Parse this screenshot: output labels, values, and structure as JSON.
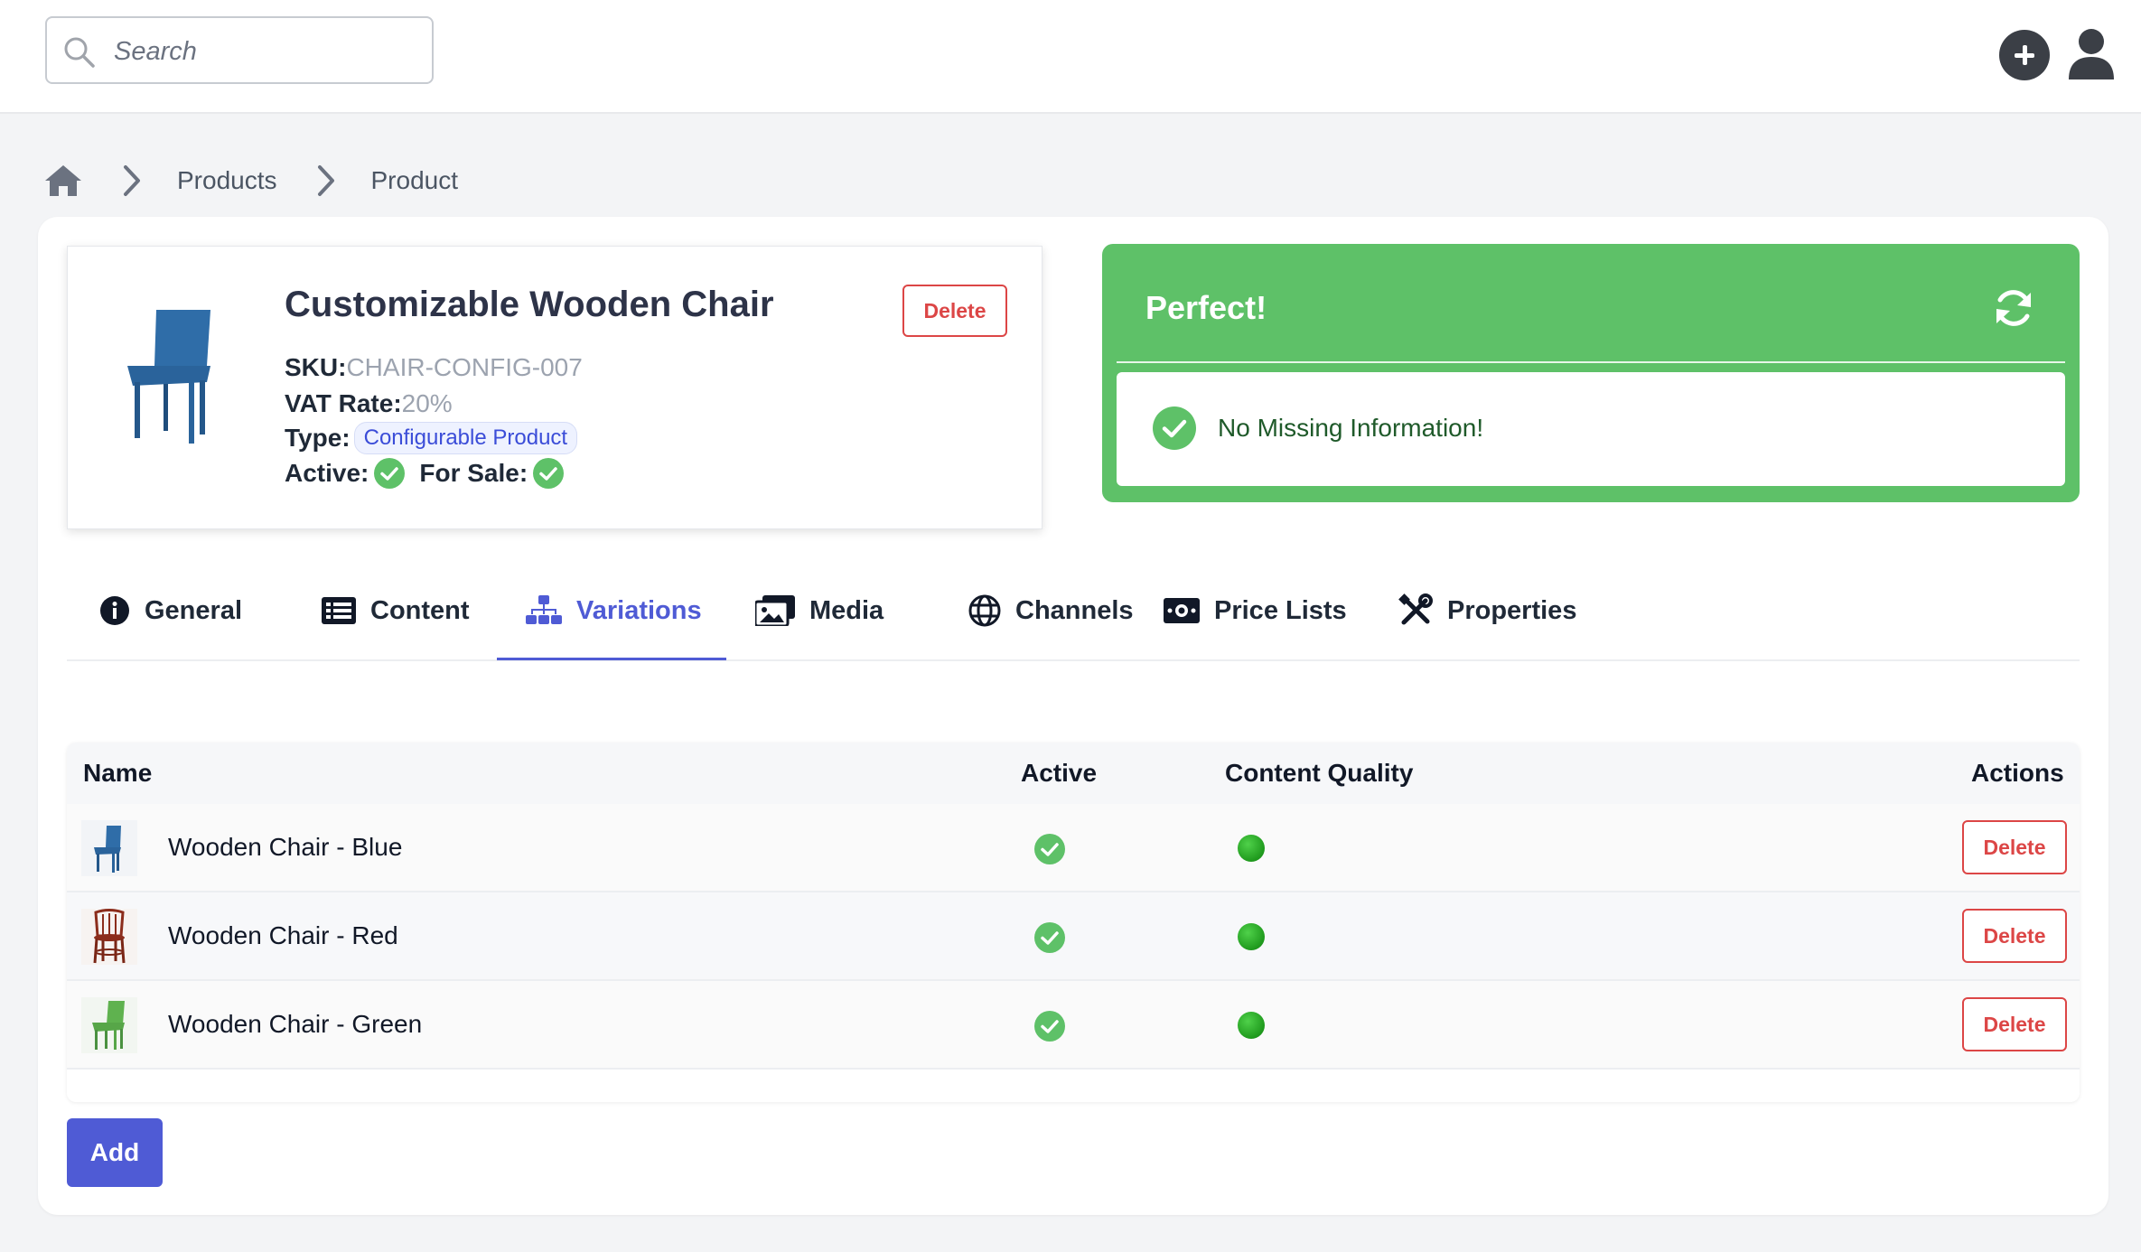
{
  "header": {
    "search_placeholder": "Search",
    "add_icon": "plus-circle-icon",
    "user_icon": "user-icon"
  },
  "breadcrumb": {
    "home_icon": "home-icon",
    "items": [
      "Products",
      "Product"
    ]
  },
  "product": {
    "title": "Customizable Wooden Chair",
    "delete_label": "Delete",
    "sku_label": "SKU:",
    "sku_value": "CHAIR-CONFIG-007",
    "vat_label": "VAT Rate:",
    "vat_value": "20%",
    "type_label": "Type:",
    "type_value": "Configurable Product",
    "active_label": "Active:",
    "for_sale_label": "For Sale:",
    "active": true,
    "for_sale": true,
    "image_color": "#2f6da8"
  },
  "status": {
    "title": "Perfect!",
    "message": "No Missing Information!",
    "color": "#5ec168",
    "refresh_icon": "refresh-icon"
  },
  "tabs": [
    {
      "label": "General",
      "icon": "info-icon",
      "active": false
    },
    {
      "label": "Content",
      "icon": "list-icon",
      "active": false
    },
    {
      "label": "Variations",
      "icon": "sitemap-icon",
      "active": true
    },
    {
      "label": "Media",
      "icon": "images-icon",
      "active": false
    },
    {
      "label": "Channels",
      "icon": "globe-icon",
      "active": false
    },
    {
      "label": "Price Lists",
      "icon": "money-icon",
      "active": false
    },
    {
      "label": "Properties",
      "icon": "tools-icon",
      "active": false
    }
  ],
  "table": {
    "columns": [
      "Name",
      "Active",
      "Content Quality",
      "Actions"
    ],
    "rows": [
      {
        "name": "Wooden Chair - Blue",
        "active": true,
        "quality": "good",
        "action": "Delete",
        "color": "#2f6da8"
      },
      {
        "name": "Wooden Chair - Red",
        "active": true,
        "quality": "good",
        "action": "Delete",
        "color": "#8c2d1c"
      },
      {
        "name": "Wooden Chair - Green",
        "active": true,
        "quality": "good",
        "action": "Delete",
        "color": "#5fb24f"
      }
    ]
  },
  "add_label": "Add",
  "colors": {
    "accent": "#4f5bd5",
    "danger": "#dc4646",
    "success": "#5ec168"
  }
}
